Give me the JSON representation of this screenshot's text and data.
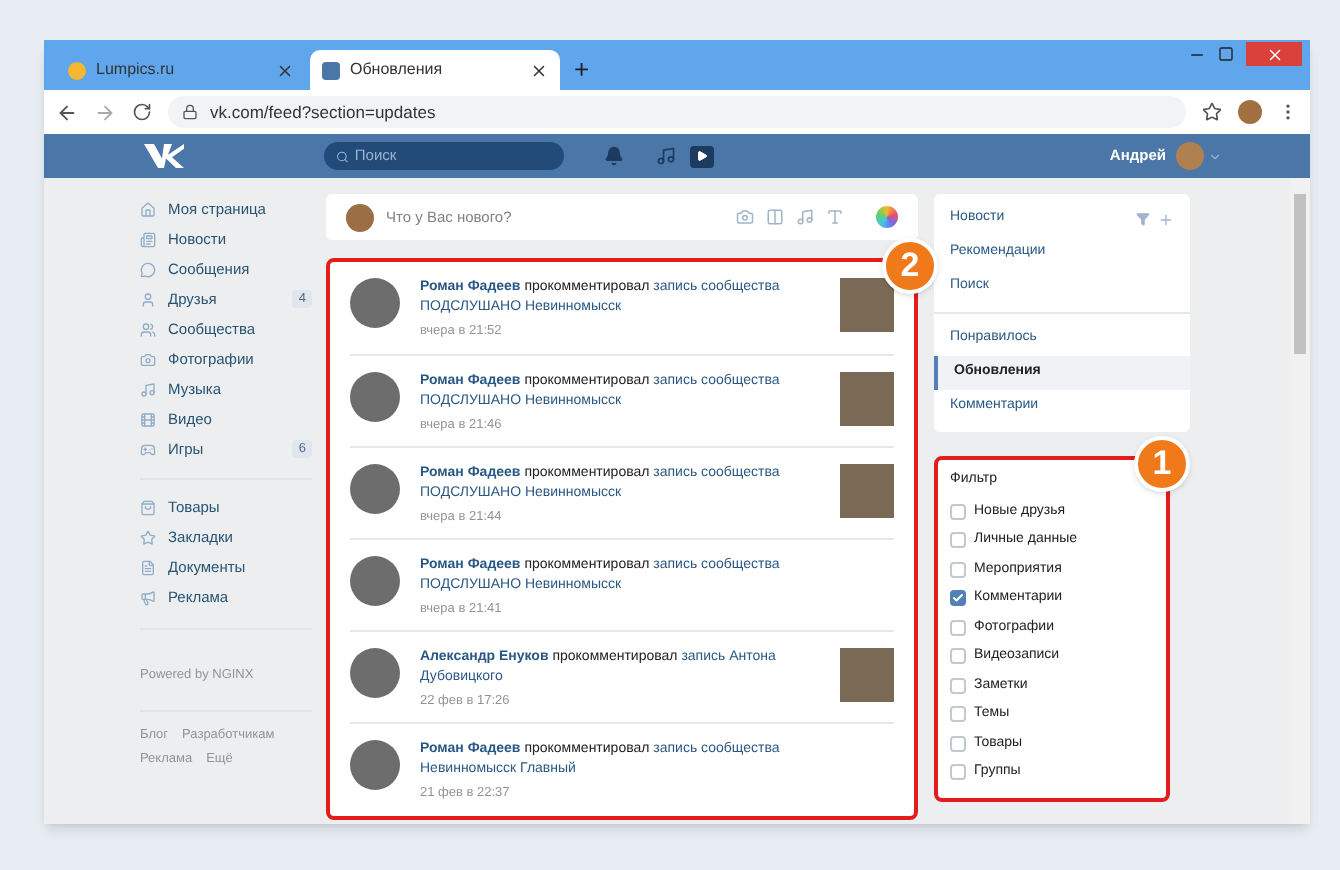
{
  "browser": {
    "tabs": [
      {
        "title": "Lumpics.ru",
        "selected": false
      },
      {
        "title": "Обновления",
        "selected": true
      }
    ],
    "new_tab": "+",
    "url": "vk.com/feed?section=updates"
  },
  "header": {
    "search_placeholder": "Поиск",
    "user_name": "Андрей"
  },
  "sidebar": {
    "groups": [
      [
        {
          "label": "Моя страница"
        },
        {
          "label": "Новости"
        },
        {
          "label": "Сообщения"
        },
        {
          "label": "Друзья",
          "count": "4"
        },
        {
          "label": "Сообщества"
        },
        {
          "label": "Фотографии"
        },
        {
          "label": "Музыка"
        },
        {
          "label": "Видео"
        },
        {
          "label": "Игры",
          "count": "6"
        }
      ],
      [
        {
          "label": "Товары"
        },
        {
          "label": "Закладки"
        },
        {
          "label": "Документы"
        },
        {
          "label": "Реклама"
        }
      ]
    ],
    "powered": "Powered by NGINX",
    "footer_links": [
      "Блог",
      "Разработчикам",
      "Реклама",
      "Ещё"
    ]
  },
  "composer": {
    "placeholder": "Что у Вас нового?"
  },
  "feed": {
    "callout": "2",
    "items": [
      {
        "author": "Роман Фадеев",
        "action": "прокомментировал",
        "target": "запись сообщества ПОДСЛУШАНО Невинномысск",
        "time": "вчера в 21:52",
        "thumbnail": true
      },
      {
        "author": "Роман Фадеев",
        "action": "прокомментировал",
        "target": "запись сообщества ПОДСЛУШАНО Невинномысск",
        "time": "вчера в 21:46",
        "thumbnail": true
      },
      {
        "author": "Роман Фадеев",
        "action": "прокомментировал",
        "target": "запись сообщества ПОДСЛУШАНО Невинномысск",
        "time": "вчера в 21:44",
        "thumbnail": true
      },
      {
        "author": "Роман Фадеев",
        "action": "прокомментировал",
        "target": "запись сообщества ПОДСЛУШАНО Невинномысск",
        "time": "вчера в 21:41",
        "thumbnail": false
      },
      {
        "author": "Александр Енуков",
        "action": "прокомментировал",
        "target": "запись Антона Дубовицкого",
        "time": "22 фев в 17:26",
        "thumbnail": true
      },
      {
        "author": "Роман Фадеев",
        "action": "прокомментировал",
        "target": "запись сообщества Невинномысск Главный",
        "time": "21 фев в 22:37",
        "thumbnail": false
      }
    ]
  },
  "menu": {
    "groups": [
      [
        {
          "label": "Новости",
          "selected": false
        },
        {
          "label": "Рекомендации",
          "selected": false
        },
        {
          "label": "Поиск",
          "selected": false
        }
      ],
      [
        {
          "label": "Понравилось",
          "selected": false
        },
        {
          "label": "Обновления",
          "selected": true
        },
        {
          "label": "Комментарии",
          "selected": false
        }
      ]
    ]
  },
  "filter": {
    "callout": "1",
    "title": "Фильтр",
    "options": [
      {
        "label": "Новые друзья",
        "checked": false
      },
      {
        "label": "Личные данные",
        "checked": false
      },
      {
        "label": "Мероприятия",
        "checked": false
      },
      {
        "label": "Комментарии",
        "checked": true
      },
      {
        "label": "Фотографии",
        "checked": false
      },
      {
        "label": "Видеозаписи",
        "checked": false
      },
      {
        "label": "Заметки",
        "checked": false
      },
      {
        "label": "Темы",
        "checked": false
      },
      {
        "label": "Товары",
        "checked": false
      },
      {
        "label": "Группы",
        "checked": false
      }
    ]
  }
}
